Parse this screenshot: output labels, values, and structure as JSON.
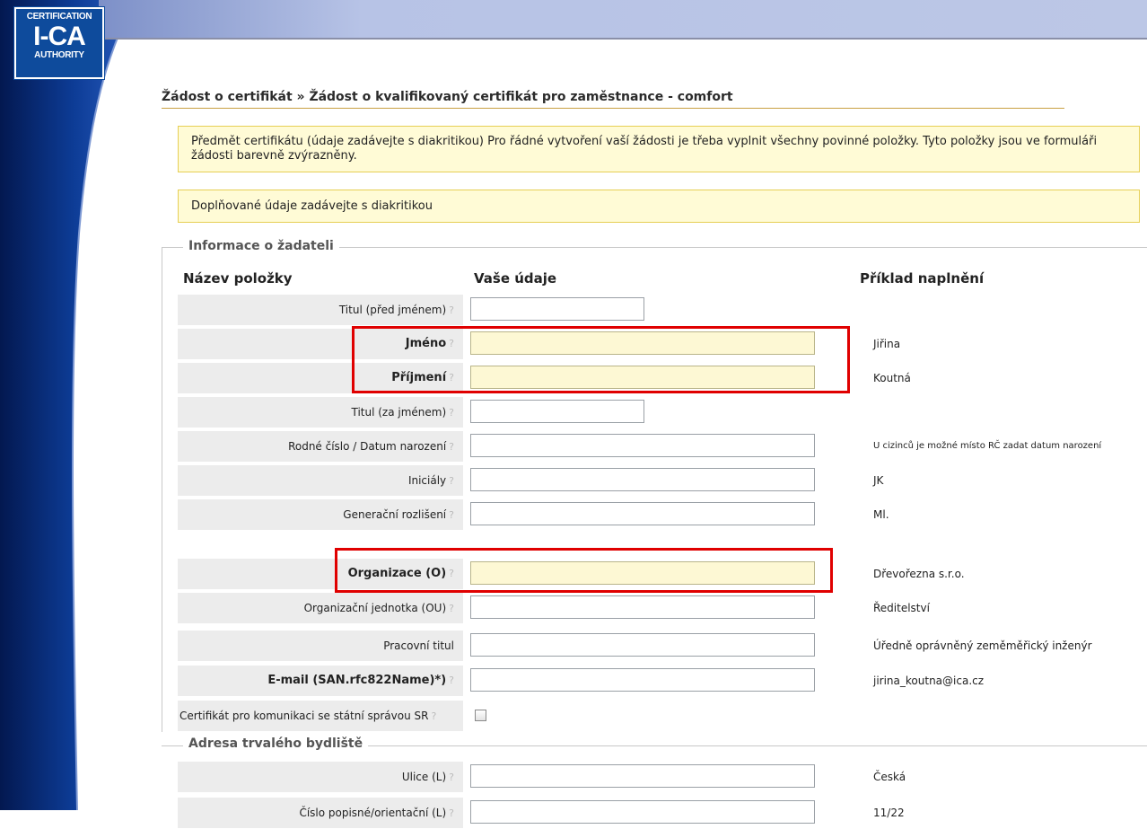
{
  "logo": {
    "line1": "CERTIFICATION",
    "line2": "I-CA",
    "line3": "AUTHORITY"
  },
  "breadcrumb": "Žádost o certifikát » Žádost o kvalifikovaný certifikát pro zaměstnance - comfort",
  "notices": [
    "Předmět certifikátu (údaje zadávejte s diakritikou) Pro řádné vytvoření vaší žádosti je třeba vyplnit všechny povinné položky. Tyto položky jsou ve formuláři žádosti barevně zvýrazněny.",
    "Doplňované údaje zadávejte s diakritikou"
  ],
  "section1": {
    "legend": "Informace o žadateli",
    "headers": {
      "name": "Název položky",
      "value": "Vaše údaje",
      "example": "Příklad naplnění"
    },
    "help": "?",
    "rows": [
      {
        "label": "Titul (před jménem)",
        "example": ""
      },
      {
        "label": "Jméno",
        "example": "Jiřina"
      },
      {
        "label": "Příjmení",
        "example": "Koutná"
      },
      {
        "label": "Titul (za jménem)",
        "example": ""
      },
      {
        "label": "Rodné číslo / Datum narození",
        "example": "U cizinců je možné místo RČ zadat datum narození"
      },
      {
        "label": "Iniciály",
        "example": "JK"
      },
      {
        "label": "Generační rozlišení",
        "example": "Ml."
      },
      {
        "label": "Organizace (O)",
        "example": "Dřevořezna s.r.o."
      },
      {
        "label": "Organizační jednotka (OU)",
        "example": "Ředitelství"
      },
      {
        "label": "Pracovní titul",
        "example": "Úředně oprávněný zeměměřický inženýr"
      },
      {
        "label": "E-mail (SAN.rfc822Name)*)",
        "example": "jirina_koutna@ica.cz"
      },
      {
        "label": "Certifikát pro komunikaci se státní správou SR",
        "example": ""
      }
    ]
  },
  "section2": {
    "legend": "Adresa trvalého bydliště",
    "rows": [
      {
        "label": "Ulice (L)",
        "example": "Česká"
      },
      {
        "label": "Číslo popisné/orientační (L)",
        "example": "11/22"
      }
    ]
  },
  "colors": {
    "banner": "#b8c4e4",
    "swoosh": "#0b2f7d",
    "required_field": "#fdf8d4",
    "notice_bg": "#fffbd6",
    "highlight": "#e00000"
  }
}
